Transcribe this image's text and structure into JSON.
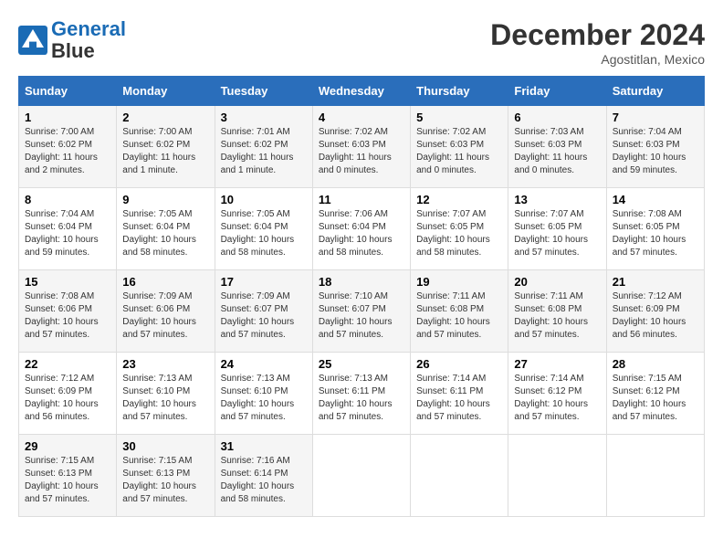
{
  "header": {
    "logo_line1": "General",
    "logo_line2": "Blue",
    "month": "December 2024",
    "location": "Agostitlan, Mexico"
  },
  "days_of_week": [
    "Sunday",
    "Monday",
    "Tuesday",
    "Wednesday",
    "Thursday",
    "Friday",
    "Saturday"
  ],
  "weeks": [
    [
      {
        "day": "1",
        "info": "Sunrise: 7:00 AM\nSunset: 6:02 PM\nDaylight: 11 hours and 2 minutes."
      },
      {
        "day": "2",
        "info": "Sunrise: 7:00 AM\nSunset: 6:02 PM\nDaylight: 11 hours and 1 minute."
      },
      {
        "day": "3",
        "info": "Sunrise: 7:01 AM\nSunset: 6:02 PM\nDaylight: 11 hours and 1 minute."
      },
      {
        "day": "4",
        "info": "Sunrise: 7:02 AM\nSunset: 6:03 PM\nDaylight: 11 hours and 0 minutes."
      },
      {
        "day": "5",
        "info": "Sunrise: 7:02 AM\nSunset: 6:03 PM\nDaylight: 11 hours and 0 minutes."
      },
      {
        "day": "6",
        "info": "Sunrise: 7:03 AM\nSunset: 6:03 PM\nDaylight: 11 hours and 0 minutes."
      },
      {
        "day": "7",
        "info": "Sunrise: 7:04 AM\nSunset: 6:03 PM\nDaylight: 10 hours and 59 minutes."
      }
    ],
    [
      {
        "day": "8",
        "info": "Sunrise: 7:04 AM\nSunset: 6:04 PM\nDaylight: 10 hours and 59 minutes."
      },
      {
        "day": "9",
        "info": "Sunrise: 7:05 AM\nSunset: 6:04 PM\nDaylight: 10 hours and 58 minutes."
      },
      {
        "day": "10",
        "info": "Sunrise: 7:05 AM\nSunset: 6:04 PM\nDaylight: 10 hours and 58 minutes."
      },
      {
        "day": "11",
        "info": "Sunrise: 7:06 AM\nSunset: 6:04 PM\nDaylight: 10 hours and 58 minutes."
      },
      {
        "day": "12",
        "info": "Sunrise: 7:07 AM\nSunset: 6:05 PM\nDaylight: 10 hours and 58 minutes."
      },
      {
        "day": "13",
        "info": "Sunrise: 7:07 AM\nSunset: 6:05 PM\nDaylight: 10 hours and 57 minutes."
      },
      {
        "day": "14",
        "info": "Sunrise: 7:08 AM\nSunset: 6:05 PM\nDaylight: 10 hours and 57 minutes."
      }
    ],
    [
      {
        "day": "15",
        "info": "Sunrise: 7:08 AM\nSunset: 6:06 PM\nDaylight: 10 hours and 57 minutes."
      },
      {
        "day": "16",
        "info": "Sunrise: 7:09 AM\nSunset: 6:06 PM\nDaylight: 10 hours and 57 minutes."
      },
      {
        "day": "17",
        "info": "Sunrise: 7:09 AM\nSunset: 6:07 PM\nDaylight: 10 hours and 57 minutes."
      },
      {
        "day": "18",
        "info": "Sunrise: 7:10 AM\nSunset: 6:07 PM\nDaylight: 10 hours and 57 minutes."
      },
      {
        "day": "19",
        "info": "Sunrise: 7:11 AM\nSunset: 6:08 PM\nDaylight: 10 hours and 57 minutes."
      },
      {
        "day": "20",
        "info": "Sunrise: 7:11 AM\nSunset: 6:08 PM\nDaylight: 10 hours and 57 minutes."
      },
      {
        "day": "21",
        "info": "Sunrise: 7:12 AM\nSunset: 6:09 PM\nDaylight: 10 hours and 56 minutes."
      }
    ],
    [
      {
        "day": "22",
        "info": "Sunrise: 7:12 AM\nSunset: 6:09 PM\nDaylight: 10 hours and 56 minutes."
      },
      {
        "day": "23",
        "info": "Sunrise: 7:13 AM\nSunset: 6:10 PM\nDaylight: 10 hours and 57 minutes."
      },
      {
        "day": "24",
        "info": "Sunrise: 7:13 AM\nSunset: 6:10 PM\nDaylight: 10 hours and 57 minutes."
      },
      {
        "day": "25",
        "info": "Sunrise: 7:13 AM\nSunset: 6:11 PM\nDaylight: 10 hours and 57 minutes."
      },
      {
        "day": "26",
        "info": "Sunrise: 7:14 AM\nSunset: 6:11 PM\nDaylight: 10 hours and 57 minutes."
      },
      {
        "day": "27",
        "info": "Sunrise: 7:14 AM\nSunset: 6:12 PM\nDaylight: 10 hours and 57 minutes."
      },
      {
        "day": "28",
        "info": "Sunrise: 7:15 AM\nSunset: 6:12 PM\nDaylight: 10 hours and 57 minutes."
      }
    ],
    [
      {
        "day": "29",
        "info": "Sunrise: 7:15 AM\nSunset: 6:13 PM\nDaylight: 10 hours and 57 minutes."
      },
      {
        "day": "30",
        "info": "Sunrise: 7:15 AM\nSunset: 6:13 PM\nDaylight: 10 hours and 57 minutes."
      },
      {
        "day": "31",
        "info": "Sunrise: 7:16 AM\nSunset: 6:14 PM\nDaylight: 10 hours and 58 minutes."
      },
      {
        "day": "",
        "info": ""
      },
      {
        "day": "",
        "info": ""
      },
      {
        "day": "",
        "info": ""
      },
      {
        "day": "",
        "info": ""
      }
    ]
  ]
}
